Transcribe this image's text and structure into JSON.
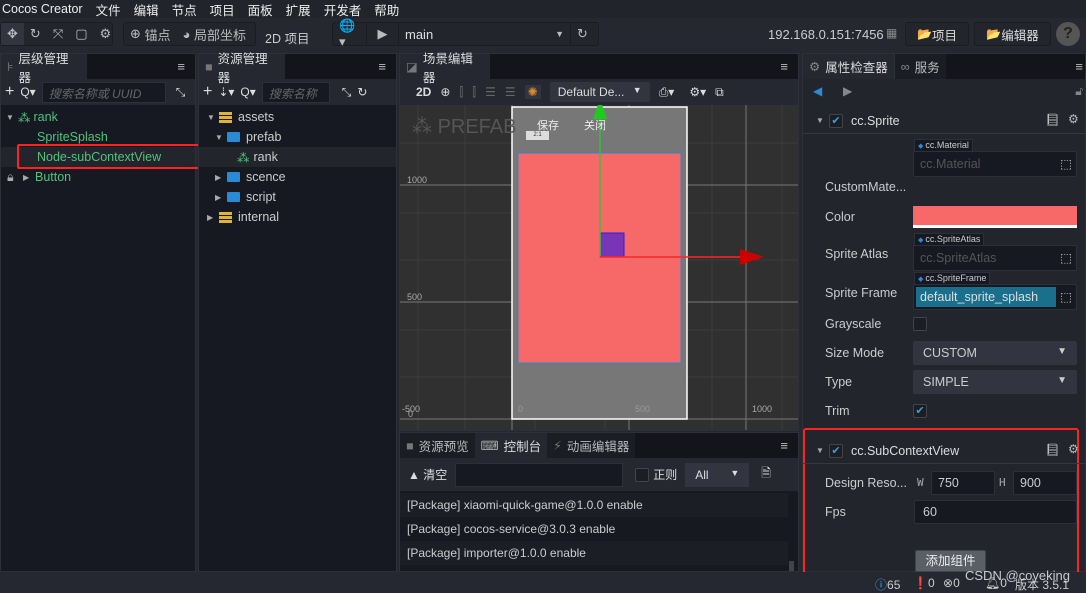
{
  "menubar": {
    "app": "Cocos Creator",
    "items": [
      "文件",
      "编辑",
      "节点",
      "项目",
      "面板",
      "扩展",
      "开发者",
      "帮助"
    ]
  },
  "toolbar": {
    "anchor": "锚点",
    "local": "局部坐标",
    "mode": "2D 项目",
    "scene": "main",
    "ip": "192.168.0.151:7456",
    "project": "项目",
    "editor": "编辑器",
    "help": "?"
  },
  "hierarchy": {
    "title": "层级管理器",
    "search_placeholder": "搜索名称或 UUID",
    "nodes": [
      {
        "label": "rank"
      },
      {
        "label": "SpriteSplash"
      },
      {
        "label": "Node-subContextView"
      },
      {
        "label": "Button"
      }
    ]
  },
  "assets": {
    "title": "资源管理器",
    "search_placeholder": "搜索名称",
    "items": [
      {
        "label": "assets"
      },
      {
        "label": "prefab"
      },
      {
        "label": "rank"
      },
      {
        "label": "scence"
      },
      {
        "label": "script"
      },
      {
        "label": "internal"
      }
    ]
  },
  "scene": {
    "title": "场景编辑器",
    "mode": "2D",
    "camera": "Default De...",
    "prefab_label": "PREFAB",
    "save": "保存",
    "close": "关闭",
    "ratio": "2:1",
    "y_ticks": [
      "1000",
      "500",
      "-500"
    ],
    "x_ticks": [
      "0",
      "500",
      "1000"
    ],
    "origin": "0",
    "sprite_color": "#f76868"
  },
  "console": {
    "tabs": [
      "资源预览",
      "控制台",
      "动画编辑器"
    ],
    "clear": "清空",
    "regex": "正则",
    "level": "All",
    "logs": [
      "[Package] xiaomi-quick-game@1.0.0 enable",
      "[Package] cocos-service@3.0.3 enable",
      "[Package] importer@1.0.0 enable"
    ]
  },
  "inspector": {
    "tabs": [
      "属性检查器",
      "服务"
    ],
    "sprite": {
      "name": "cc.Sprite",
      "custom_material_label": "CustomMate...",
      "material_tag": "cc.Material",
      "material_value": "cc.Material",
      "color_label": "Color",
      "color": "#f76868",
      "atlas_label": "Sprite Atlas",
      "atlas_tag": "cc.SpriteAtlas",
      "atlas_value": "cc.SpriteAtlas",
      "frame_label": "Sprite Frame",
      "frame_tag": "cc.SpriteFrame",
      "frame_value": "default_sprite_splash",
      "grayscale_label": "Grayscale",
      "grayscale": false,
      "size_mode_label": "Size Mode",
      "size_mode": "CUSTOM",
      "type_label": "Type",
      "type": "SIMPLE",
      "trim_label": "Trim",
      "trim": true
    },
    "subcontext": {
      "name": "cc.SubContextView",
      "design_label": "Design Reso...",
      "w_label": "W",
      "w": "750",
      "h_label": "H",
      "h": "900",
      "fps_label": "Fps",
      "fps": "60"
    },
    "add_component": "添加组件"
  },
  "status": {
    "info": "65",
    "warn": "0",
    "error": "0",
    "notify": "0",
    "version": "版本 3.5.1",
    "watermark": "CSDN @coyeking"
  },
  "colors": {
    "highlight_box": "#ff2222",
    "node_green": "#4fc37b",
    "accent": "#2a8ad4"
  }
}
